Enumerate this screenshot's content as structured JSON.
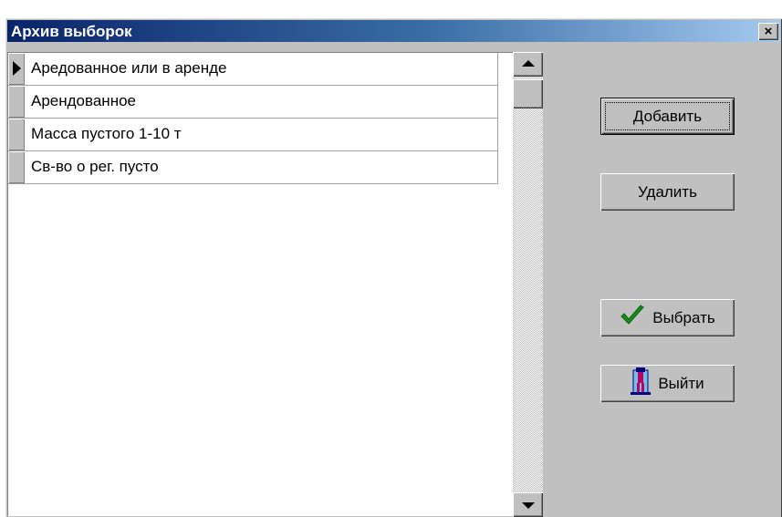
{
  "window": {
    "title": "Архив выборок",
    "close_glyph": "×"
  },
  "list": {
    "rows": [
      {
        "label": "Аредованное или в аренде",
        "current": true
      },
      {
        "label": "Арендованное",
        "current": false
      },
      {
        "label": "Масса пустого 1-10 т",
        "current": false
      },
      {
        "label": "Св-во о рег. пусто",
        "current": false
      }
    ]
  },
  "buttons": {
    "add_label": "Добавить",
    "delete_label": "Удалить",
    "select_label": "Выбрать",
    "exit_label": "Выйти"
  },
  "icons": {
    "select_icon": "checkmark-icon",
    "exit_icon": "exit-door-icon",
    "checkmark_color": "#1a8c1a"
  },
  "colors": {
    "title_gradient_start": "#0a246a",
    "title_gradient_end": "#a6caf0",
    "face": "#c0c0c0"
  }
}
